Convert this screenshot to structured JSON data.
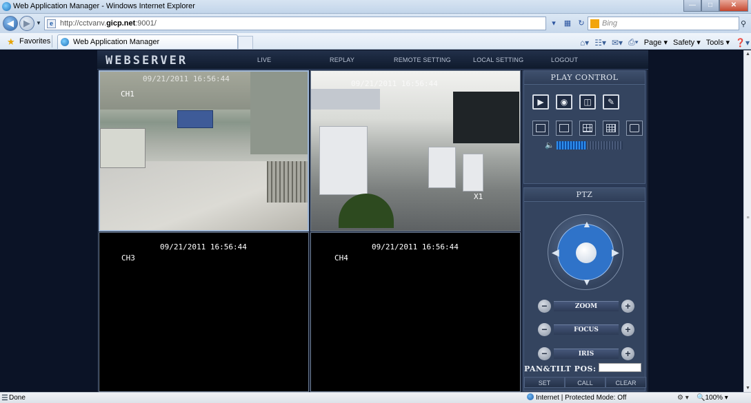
{
  "window": {
    "title": "Web Application Manager - Windows Internet Explorer"
  },
  "address": {
    "url_prefix": "http://cctvanv.",
    "url_host": "gicp.net",
    "url_suffix": ":9001/"
  },
  "search": {
    "placeholder": "Bing"
  },
  "favorites": {
    "label": "Favorites",
    "tab_label": "Web Application Manager"
  },
  "commands": {
    "page": "Page",
    "safety": "Safety",
    "tools": "Tools"
  },
  "app": {
    "logo": "WEBSERVER",
    "menu": [
      "LIVE",
      "REPLAY",
      "REMOTE SETTING",
      "LOCAL SETTING",
      "LOGOUT"
    ]
  },
  "cameras": [
    {
      "channel": "CH1",
      "timestamp": "09/21/2011 16:56:44"
    },
    {
      "channel": "",
      "timestamp": "09/21/2011 16:56:44",
      "zoom": "X1"
    },
    {
      "channel": "CH3",
      "timestamp": "09/21/2011 16:56:44"
    },
    {
      "channel": "CH4",
      "timestamp": "09/21/2011 16:56:44"
    }
  ],
  "play_control": {
    "title": "PLAY CONTROL",
    "volume_level": 0.45
  },
  "ptz": {
    "title": "PTZ",
    "zoom_label": "ZOOM",
    "focus_label": "FOCUS",
    "iris_label": "IRIS",
    "pos_label": "PAN&TILT POS:",
    "set_label": "SET",
    "call_label": "CALL",
    "clear_label": "CLEAR"
  },
  "status": {
    "text": "Done",
    "zone": "Internet | Protected Mode: Off",
    "zoom": "100%"
  }
}
